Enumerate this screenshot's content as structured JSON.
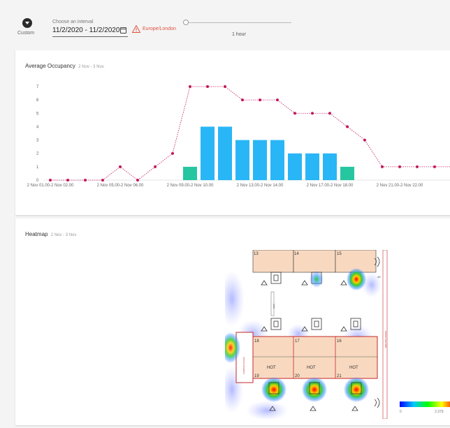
{
  "filter": {
    "custom_label": "Custom",
    "interval_caption": "Choose an interval",
    "interval_value": "11/2/2020 - 11/2/2020",
    "timezone": "Europe/London",
    "slider_label": "1 hour"
  },
  "occupancy": {
    "title": "Average Occupancy",
    "range": "2 Nov - 3 Nov"
  },
  "heatmap": {
    "title": "Heatmap",
    "range": "2 Nov - 3 Nov",
    "legend_min": "0",
    "legend_max": "2.379",
    "rooms": [
      "13",
      "14",
      "15",
      "18",
      "17",
      "16",
      "19",
      "20",
      "21"
    ],
    "hot_label": "HOT"
  },
  "colors": {
    "line": "#c2185b",
    "bar": "#29b6f6",
    "bar_low": "#26c6a1",
    "warning": "#e0533f"
  },
  "chart_data": {
    "type": "bar",
    "x_tick_labels": [
      "2 Nov 01.00-2 Nov 02.00",
      "2 Nov 05.00-2 Nov 06.00",
      "2 Nov 09.00-2 Nov 10.00",
      "2 Nov 13.00-2 Nov 14.00",
      "2 Nov 17.00-2 Nov 18.00",
      "2 Nov 21.00-2 Nov 22.00"
    ],
    "y_ticks": [
      0,
      1,
      2,
      3,
      4,
      5,
      6,
      7
    ],
    "ylim": [
      0,
      7
    ],
    "hours": [
      1,
      2,
      3,
      4,
      5,
      6,
      7,
      8,
      9,
      10,
      11,
      12,
      13,
      14,
      15,
      16,
      17,
      18,
      19,
      20,
      21,
      22,
      23,
      24
    ],
    "series": [
      {
        "type": "line",
        "values": [
          0,
          0,
          0,
          0,
          1,
          0,
          1,
          2,
          7,
          7,
          7,
          6,
          6,
          6,
          5,
          5,
          5,
          4,
          3,
          1,
          1,
          1,
          1,
          1
        ]
      },
      {
        "type": "bar",
        "values": [
          0,
          0,
          0,
          0,
          0,
          0,
          0,
          0,
          1,
          4,
          4,
          3,
          3,
          3,
          2,
          2,
          2,
          1,
          0,
          0,
          0,
          0,
          0,
          0
        ]
      }
    ]
  }
}
